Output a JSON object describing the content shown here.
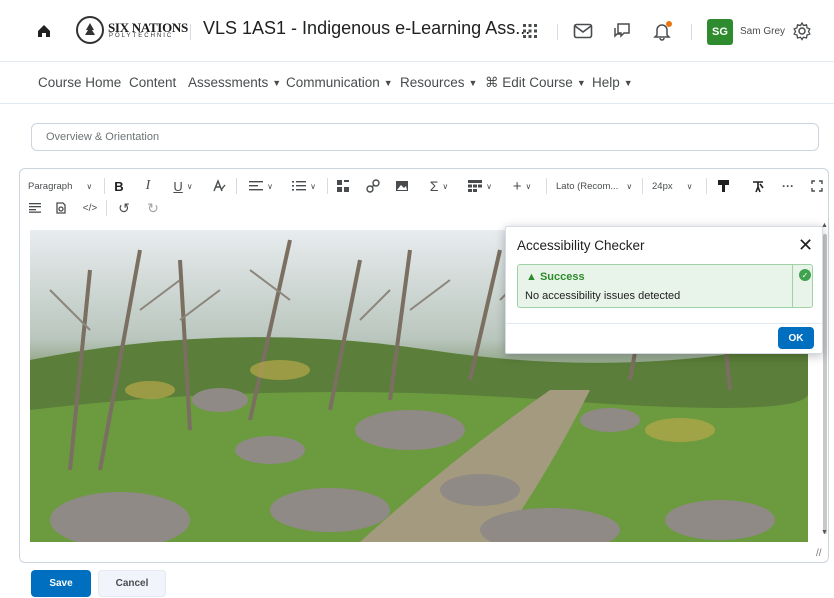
{
  "header": {
    "logo_text": "SIX NATIONS",
    "logo_subtext": "POLYTECHNIC",
    "course_title": "VLS 1AS1 - Indigenous e-Learning Ass...",
    "user_initials": "SG",
    "user_name": "Sam Grey",
    "icons": [
      "home-icon",
      "waffle-icon",
      "mail-icon",
      "chat-icon",
      "bell-icon",
      "gear-icon"
    ],
    "notification_color": "#e87511",
    "avatar_color": "#2e8b2e"
  },
  "navbar": {
    "items": [
      {
        "label": "Course Home"
      },
      {
        "label": "Content"
      },
      {
        "label": "Assessments"
      },
      {
        "label": "Communication"
      },
      {
        "label": "Resources"
      },
      {
        "label": "Edit Course"
      },
      {
        "label": "Help"
      }
    ]
  },
  "title_field": {
    "value": "Overview & Orientation"
  },
  "toolbar": {
    "format_select": "Paragraph",
    "font_select": "Lato (Recom...",
    "size_select": "24px",
    "bold": "B",
    "italic": "I",
    "underline": "U"
  },
  "dialog": {
    "title": "Accessibility Checker",
    "status": "Success",
    "message": "No accessibility issues detected",
    "ok_label": "OK",
    "success_color": "#2e8b2e"
  },
  "actions": {
    "save_label": "Save",
    "cancel_label": "Cancel",
    "primary_color": "#006fbf"
  }
}
